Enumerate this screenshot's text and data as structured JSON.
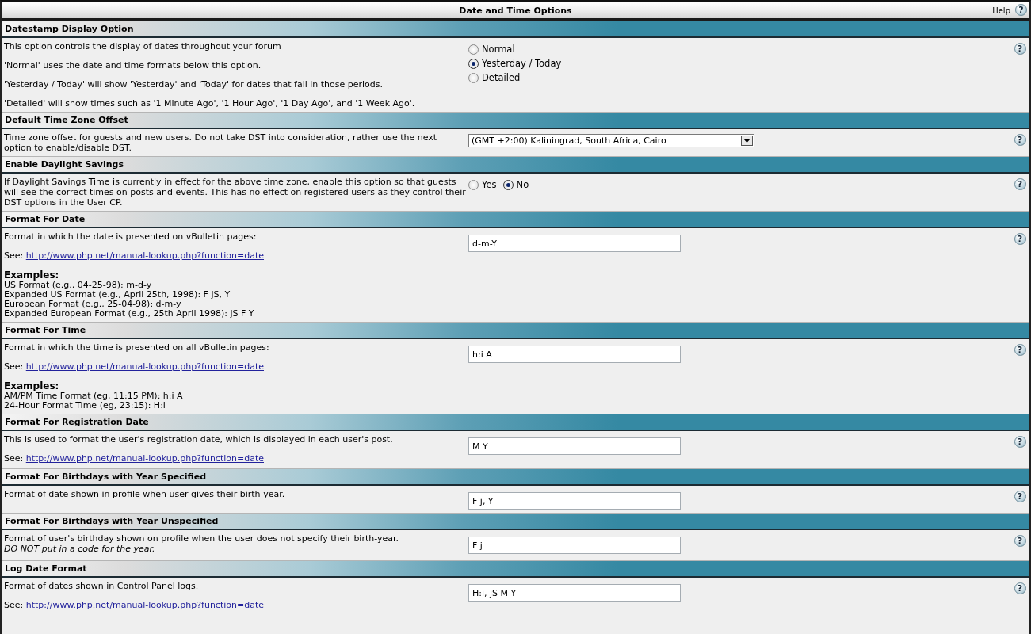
{
  "panel": {
    "title": "Date and Time Options",
    "help": {
      "label": "Help",
      "icon": "?"
    }
  },
  "settings": [
    {
      "title": "Datestamp Display Option",
      "description": [
        "This option controls the display of dates throughout your forum",
        "'Normal' uses the date and time formats below this option.",
        "'Yesterday / Today' will show 'Yesterday' and 'Today' for dates that fall in those periods.",
        "'Detailed' will show times such as '1 Minute Ago', '1 Hour Ago', '1 Day Ago', and '1 Week Ago'."
      ],
      "control": {
        "kind": "radio_list",
        "options": [
          {
            "label": "Normal",
            "selected": false
          },
          {
            "label": "Yesterday / Today",
            "selected": true
          },
          {
            "label": "Detailed",
            "selected": false
          }
        ]
      },
      "help": "?"
    },
    {
      "title": "Default Time Zone Offset",
      "description": [
        "Time zone offset for guests and new users. Do not take DST into consideration, rather use the next option to enable/disable DST."
      ],
      "control": {
        "kind": "select",
        "value": "(GMT +2:00) Kaliningrad, South Africa, Cairo"
      },
      "help": "?"
    },
    {
      "title": "Enable Daylight Savings",
      "description": [
        "If Daylight Savings Time is currently in effect for the above time zone, enable this option so that guests will see the correct times on posts and events. This has no effect on registered users as they control their DST options in the User CP."
      ],
      "control": {
        "kind": "radio_inline",
        "options": [
          {
            "label": "Yes",
            "selected": false
          },
          {
            "label": "No",
            "selected": true
          }
        ]
      },
      "help": "?"
    },
    {
      "title": "Format For Date",
      "description": [
        "Format in which the date is presented on vBulletin pages:"
      ],
      "see": {
        "label": "See:",
        "link": "http://www.php.net/manual-lookup.php?function=date"
      },
      "examples": {
        "heading": "Examples:",
        "lines": [
          "US Format (e.g., 04-25-98): m-d-y",
          "Expanded US Format (e.g., April 25th, 1998): F jS, Y",
          "European Format (e.g., 25-04-98): d-m-y",
          "Expanded European Format (e.g., 25th April 1998): jS F Y"
        ]
      },
      "control": {
        "kind": "text",
        "value": "d-m-Y"
      },
      "help": "?"
    },
    {
      "title": "Format For Time",
      "description": [
        "Format in which the time is presented on all vBulletin pages:"
      ],
      "see": {
        "label": "See:",
        "link": "http://www.php.net/manual-lookup.php?function=date"
      },
      "examples": {
        "heading": "Examples:",
        "lines": [
          "AM/PM Time Format (eg, 11:15 PM): h:i A",
          "24-Hour Format Time (eg, 23:15): H:i"
        ]
      },
      "control": {
        "kind": "text",
        "value": "h:i A"
      },
      "help": "?"
    },
    {
      "title": "Format For Registration Date",
      "description": [
        "This is used to format the user's registration date, which is displayed in each user's post."
      ],
      "see": {
        "label": "See:",
        "link": "http://www.php.net/manual-lookup.php?function=date"
      },
      "control": {
        "kind": "text",
        "value": "M Y"
      },
      "help": "?"
    },
    {
      "title": "Format For Birthdays with Year Specified",
      "description": [
        "Format of date shown in profile when user gives their birth-year."
      ],
      "control": {
        "kind": "text",
        "value": "F j, Y"
      },
      "help": "?"
    },
    {
      "title": "Format For Birthdays with Year Unspecified",
      "description": [
        "Format of user's birthday shown on profile when the user does not specify their birth-year."
      ],
      "note": "DO NOT put in a code for the year.",
      "control": {
        "kind": "text",
        "value": "F j"
      },
      "help": "?"
    },
    {
      "title": "Log Date Format",
      "description": [
        "Format of dates shown in Control Panel logs."
      ],
      "see": {
        "label": "See:",
        "link": "http://www.php.net/manual-lookup.php?function=date"
      },
      "control": {
        "kind": "text",
        "value": "H:i, jS M Y"
      },
      "help": "?"
    }
  ]
}
